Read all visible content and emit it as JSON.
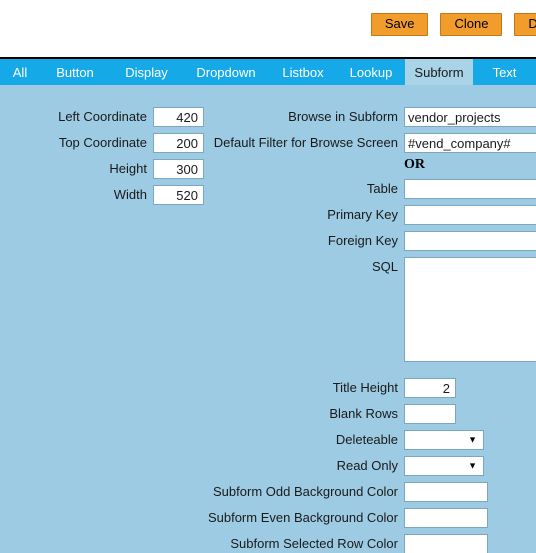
{
  "toolbar": {
    "buttons": [
      {
        "label": "Save",
        "name": "save-button"
      },
      {
        "label": "Clone",
        "name": "clone-button"
      },
      {
        "label": "Delete",
        "name": "delete-button"
      }
    ]
  },
  "tabs": {
    "items": [
      {
        "label": "All"
      },
      {
        "label": "Button"
      },
      {
        "label": "Display"
      },
      {
        "label": "Dropdown"
      },
      {
        "label": "Listbox"
      },
      {
        "label": "Lookup"
      },
      {
        "label": "Subform"
      },
      {
        "label": "Text"
      }
    ],
    "active": "Subform"
  },
  "form": {
    "left_column": [
      {
        "label": "Left Coordinate",
        "value": "420"
      },
      {
        "label": "Top Coordinate",
        "value": "200"
      },
      {
        "label": "Height",
        "value": "300"
      },
      {
        "label": "Width",
        "value": "520"
      }
    ],
    "browse_in_subform": {
      "label": "Browse in Subform",
      "value": "vendor_projects"
    },
    "default_filter": {
      "label": "Default Filter for Browse Screen",
      "value": "#vend_company#"
    },
    "or_separator": "OR",
    "table": {
      "label": "Table",
      "value": ""
    },
    "primary_key": {
      "label": "Primary Key",
      "value": ""
    },
    "foreign_key": {
      "label": "Foreign Key",
      "value": ""
    },
    "sql": {
      "label": "SQL",
      "value": ""
    },
    "title_height": {
      "label": "Title Height",
      "value": "2"
    },
    "blank_rows": {
      "label": "Blank Rows",
      "value": ""
    },
    "deleteable": {
      "label": "Deleteable",
      "value": ""
    },
    "read_only": {
      "label": "Read Only",
      "value": ""
    },
    "odd_bg_color": {
      "label": "Subform Odd Background Color",
      "value": ""
    },
    "even_bg_color": {
      "label": "Subform Even Background Color",
      "value": ""
    },
    "selected_row_color": {
      "label": "Subform Selected Row Color",
      "value": ""
    }
  },
  "colors": {
    "page_background": "#9dcbe3",
    "tab_bar": "#16a9e8",
    "tab_active": "#a9d4e8",
    "button": "#f29c2c",
    "field_border": "#7ba7c0"
  }
}
